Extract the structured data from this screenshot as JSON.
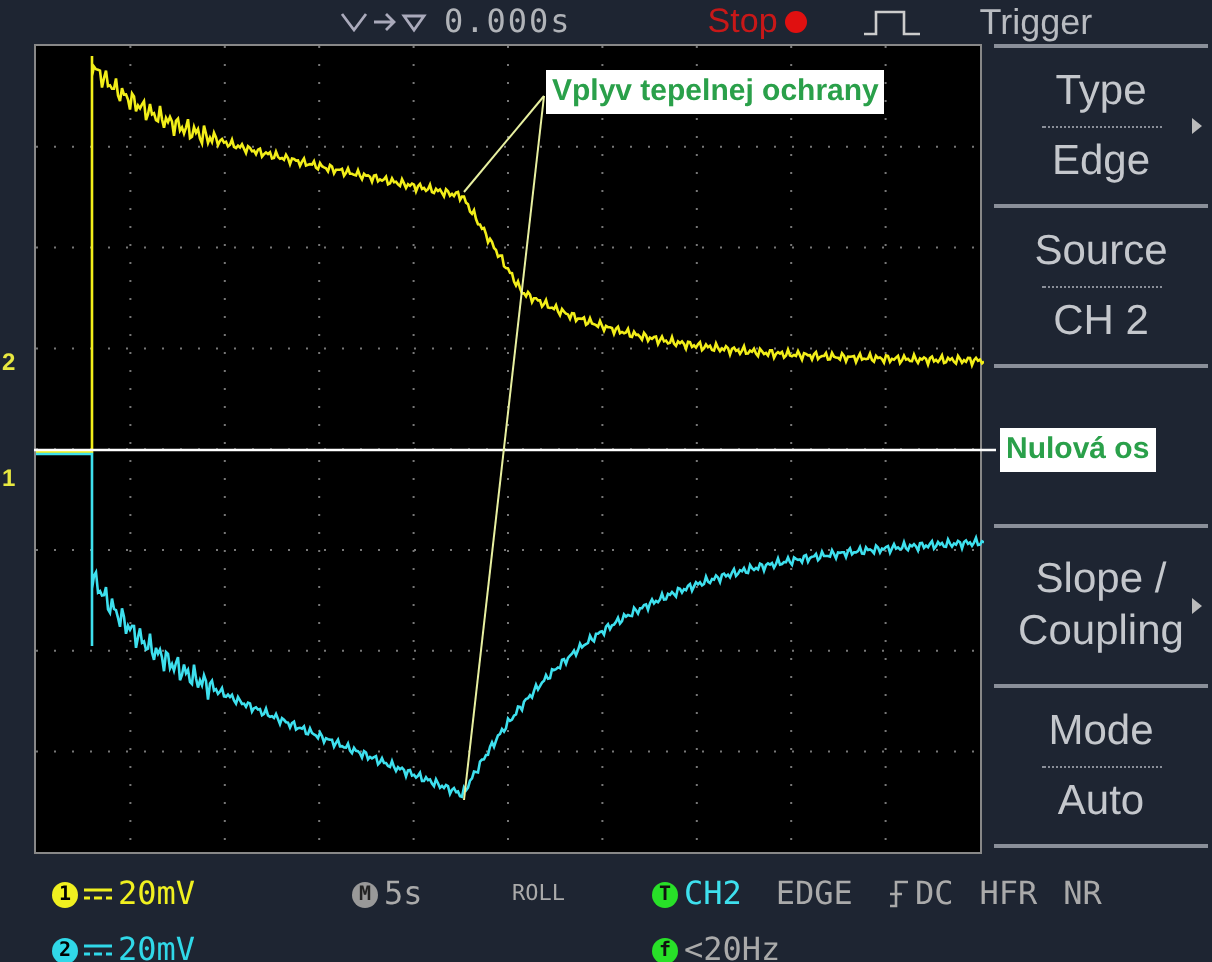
{
  "top_bar": {
    "position": "0.000s",
    "run_state": "Stop",
    "menu_title": "Trigger"
  },
  "channel_markers": [
    {
      "label": "2",
      "color": "#e8e840"
    },
    {
      "label": "1",
      "color": "#e8e840"
    }
  ],
  "menu": [
    {
      "kind": "pair",
      "label": "Type",
      "value": "Edge",
      "submenu": true
    },
    {
      "kind": "pair",
      "label": "Source",
      "value": "CH 2",
      "submenu": false
    },
    {
      "kind": "blank"
    },
    {
      "kind": "single",
      "label": "Slope / Coupling",
      "submenu": true
    },
    {
      "kind": "pair",
      "label": "Mode",
      "value": "Auto",
      "submenu": false
    }
  ],
  "status_bar": {
    "channels": [
      {
        "badge": "1",
        "scale": "20mV",
        "color": "#f0f020"
      },
      {
        "badge": "2",
        "scale": "20mV",
        "color": "#30d8e8"
      }
    ],
    "timebase": {
      "badge": "M",
      "value": "5s"
    },
    "mode": "ROLL",
    "trigger": {
      "badge": "T",
      "source": "CH2",
      "type": "EDGE",
      "coupling": "DC",
      "options": [
        "HFR",
        "NR"
      ]
    },
    "frequency": {
      "badge": "f",
      "value": "<20Hz"
    }
  },
  "annotations": {
    "thermal_protection": "Vplyv tepelnej ochrany",
    "zero_axis": "Nulová os"
  }
}
